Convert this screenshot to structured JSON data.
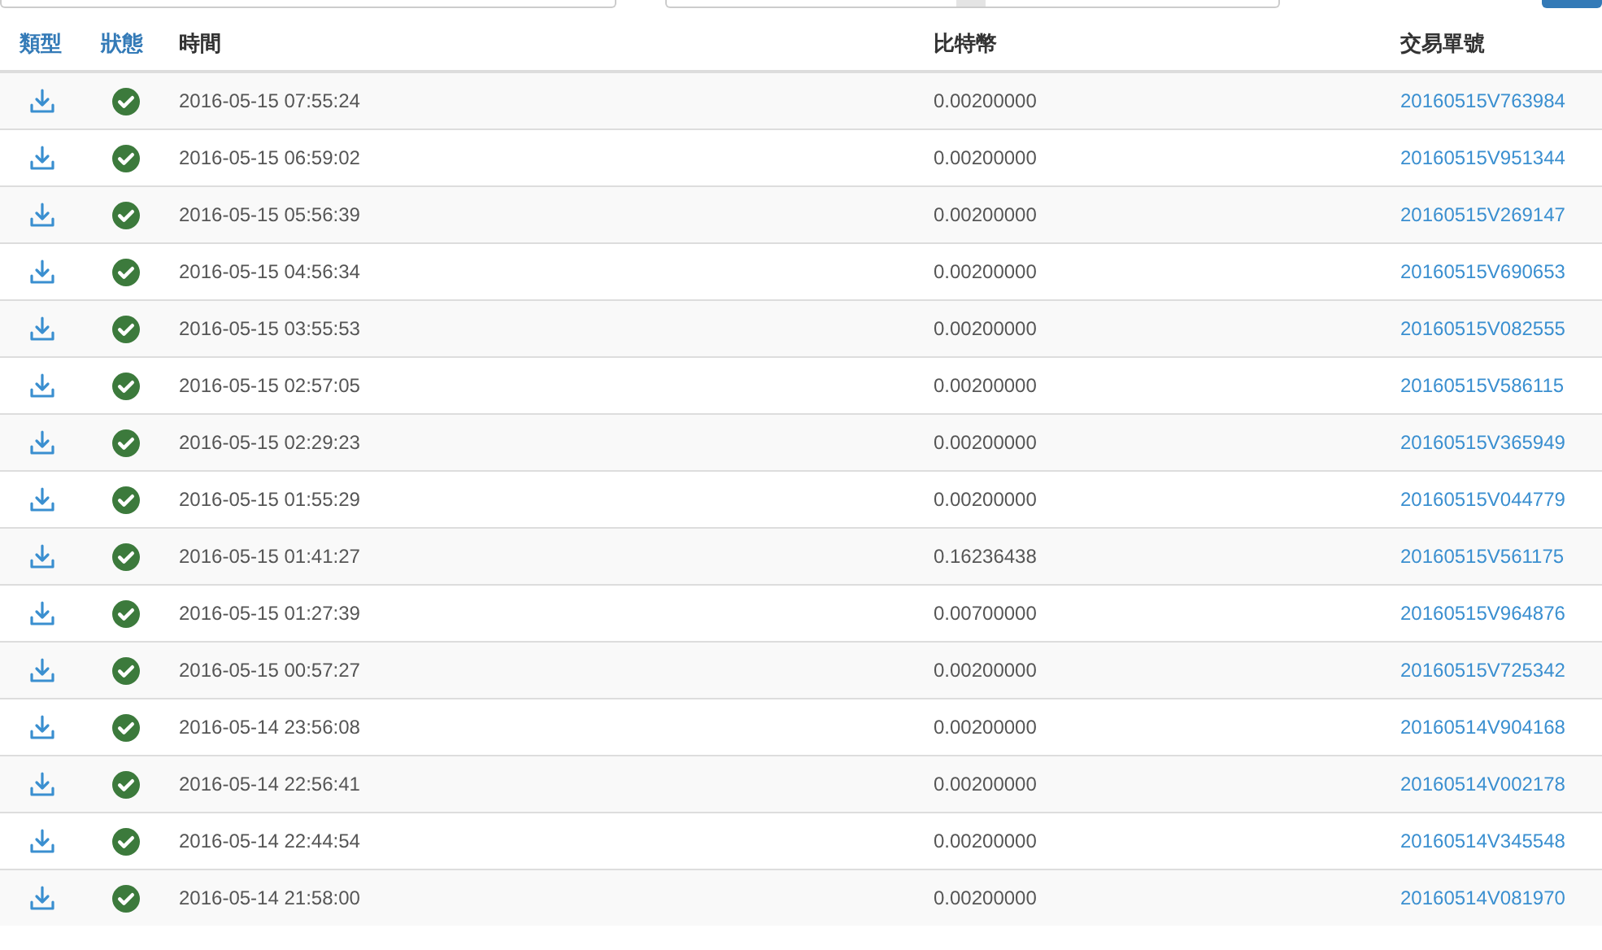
{
  "columns": [
    {
      "label": "類型",
      "sortable": true
    },
    {
      "label": "狀態",
      "sortable": true
    },
    {
      "label": "時間",
      "sortable": false
    },
    {
      "label": "比特幣",
      "sortable": false
    },
    {
      "label": "交易單號",
      "sortable": false
    }
  ],
  "rows": [
    {
      "type_icon": {
        "kind": "download"
      },
      "status_icon": {
        "kind": "check"
      },
      "time": "2016-05-15 07:55:24",
      "btc": "0.00200000",
      "tx_id": "20160515V763984"
    },
    {
      "type_icon": {
        "kind": "download"
      },
      "status_icon": {
        "kind": "check"
      },
      "time": "2016-05-15 06:59:02",
      "btc": "0.00200000",
      "tx_id": "20160515V951344"
    },
    {
      "type_icon": {
        "kind": "download"
      },
      "status_icon": {
        "kind": "check"
      },
      "time": "2016-05-15 05:56:39",
      "btc": "0.00200000",
      "tx_id": "20160515V269147"
    },
    {
      "type_icon": {
        "kind": "download"
      },
      "status_icon": {
        "kind": "check"
      },
      "time": "2016-05-15 04:56:34",
      "btc": "0.00200000",
      "tx_id": "20160515V690653"
    },
    {
      "type_icon": {
        "kind": "download"
      },
      "status_icon": {
        "kind": "check"
      },
      "time": "2016-05-15 03:55:53",
      "btc": "0.00200000",
      "tx_id": "20160515V082555"
    },
    {
      "type_icon": {
        "kind": "download"
      },
      "status_icon": {
        "kind": "check"
      },
      "time": "2016-05-15 02:57:05",
      "btc": "0.00200000",
      "tx_id": "20160515V586115"
    },
    {
      "type_icon": {
        "kind": "download"
      },
      "status_icon": {
        "kind": "check"
      },
      "time": "2016-05-15 02:29:23",
      "btc": "0.00200000",
      "tx_id": "20160515V365949"
    },
    {
      "type_icon": {
        "kind": "download"
      },
      "status_icon": {
        "kind": "check"
      },
      "time": "2016-05-15 01:55:29",
      "btc": "0.00200000",
      "tx_id": "20160515V044779"
    },
    {
      "type_icon": {
        "kind": "download"
      },
      "status_icon": {
        "kind": "check"
      },
      "time": "2016-05-15 01:41:27",
      "btc": "0.16236438",
      "tx_id": "20160515V561175"
    },
    {
      "type_icon": {
        "kind": "download"
      },
      "status_icon": {
        "kind": "check"
      },
      "time": "2016-05-15 01:27:39",
      "btc": "0.00700000",
      "tx_id": "20160515V964876"
    },
    {
      "type_icon": {
        "kind": "download"
      },
      "status_icon": {
        "kind": "check"
      },
      "time": "2016-05-15 00:57:27",
      "btc": "0.00200000",
      "tx_id": "20160515V725342"
    },
    {
      "type_icon": {
        "kind": "download"
      },
      "status_icon": {
        "kind": "check"
      },
      "time": "2016-05-14 23:56:08",
      "btc": "0.00200000",
      "tx_id": "20160514V904168"
    },
    {
      "type_icon": {
        "kind": "download"
      },
      "status_icon": {
        "kind": "check"
      },
      "time": "2016-05-14 22:56:41",
      "btc": "0.00200000",
      "tx_id": "20160514V002178"
    },
    {
      "type_icon": {
        "kind": "download"
      },
      "status_icon": {
        "kind": "check"
      },
      "time": "2016-05-14 22:44:54",
      "btc": "0.00200000",
      "tx_id": "20160514V345548"
    },
    {
      "type_icon": {
        "kind": "download"
      },
      "status_icon": {
        "kind": "check"
      },
      "time": "2016-05-14 21:58:00",
      "btc": "0.00200000",
      "tx_id": "20160514V081970"
    }
  ]
}
